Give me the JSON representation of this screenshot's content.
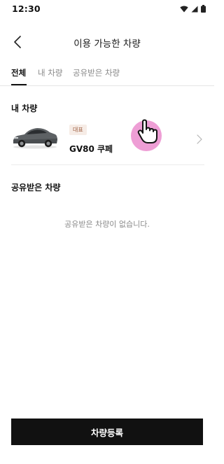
{
  "status_bar": {
    "time": "12:30",
    "icons": [
      "wifi-icon",
      "signal-icon",
      "battery-icon"
    ]
  },
  "header": {
    "title": "이용 가능한 차량",
    "back_icon": "chevron-left-icon"
  },
  "tabs": [
    {
      "label": "전체",
      "active": true
    },
    {
      "label": "내 차량",
      "active": false
    },
    {
      "label": "공유받은 차량",
      "active": false
    }
  ],
  "my_vehicles": {
    "section_title": "내 차량",
    "items": [
      {
        "badge": "대표",
        "name": "GV80 쿠페",
        "image_icon": "car-image",
        "arrow_icon": "chevron-right-icon"
      }
    ]
  },
  "shared_vehicles": {
    "section_title": "공유받은 차량",
    "empty_message": "공유받은 차량이 없습니다."
  },
  "footer": {
    "register_label": "차량등록"
  },
  "colors": {
    "primary_button": "#111111",
    "badge_background": "#f6ece6",
    "badge_text": "#9b5a3c",
    "touch_indicator": "#ee9ed5",
    "muted_text": "#8a8a8a"
  }
}
